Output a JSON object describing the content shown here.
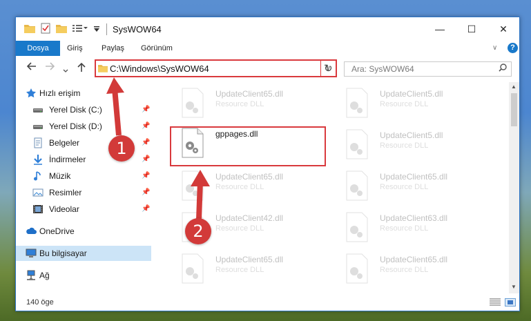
{
  "window": {
    "title": "SysWOW64",
    "minimize_glyph": "—",
    "maximize_glyph": "☐",
    "close_glyph": "✕"
  },
  "ribbon": {
    "tabs": [
      {
        "label": "Dosya"
      },
      {
        "label": "Giriş"
      },
      {
        "label": "Paylaş"
      },
      {
        "label": "Görünüm"
      }
    ],
    "expand_glyph": "∨",
    "help_glyph": "?"
  },
  "address": {
    "path": "C:\\Windows\\SysWOW64",
    "dropdown_glyph": "∨",
    "refresh_glyph": "↻"
  },
  "search": {
    "placeholder": "Ara: SysWOW64",
    "icon": "search-icon"
  },
  "nav": {
    "items": [
      {
        "label": "Hızlı erişim",
        "icon": "star-icon",
        "pinned": false
      },
      {
        "label": "Yerel Disk (C:)",
        "icon": "drive-icon",
        "pinned": true
      },
      {
        "label": "Yerel Disk (D:)",
        "icon": "drive-icon",
        "pinned": true
      },
      {
        "label": "Belgeler",
        "icon": "documents-icon",
        "pinned": true
      },
      {
        "label": "İndirmeler",
        "icon": "download-icon",
        "pinned": true
      },
      {
        "label": "Müzik",
        "icon": "music-icon",
        "pinned": true
      },
      {
        "label": "Resimler",
        "icon": "pictures-icon",
        "pinned": true
      },
      {
        "label": "Videolar",
        "icon": "videos-icon",
        "pinned": true
      },
      {
        "label": "OneDrive",
        "icon": "cloud-icon",
        "pinned": false
      },
      {
        "label": "Bu bilgisayar",
        "icon": "computer-icon",
        "pinned": false
      },
      {
        "label": "Ağ",
        "icon": "network-icon",
        "pinned": false
      }
    ]
  },
  "files": {
    "left": [
      {
        "name": "UpdateClient65.dll",
        "type": "Resource DLL"
      },
      {
        "name": "gppages.dll",
        "type": ""
      },
      {
        "name": "UpdateClient65.dll",
        "type": "Resource DLL"
      },
      {
        "name": "UpdateClient42.dll",
        "type": "Resource DLL"
      },
      {
        "name": "UpdateClient65.dll",
        "type": "Resource DLL"
      }
    ],
    "right": [
      {
        "name": "UpdateClient5.dll",
        "type": "Resource DLL"
      },
      {
        "name": "UpdateClient5.dll",
        "type": "Resource DLL"
      },
      {
        "name": "UpdateClient65.dll",
        "type": "Resource DLL"
      },
      {
        "name": "UpdateClient63.dll",
        "type": "Resource DLL"
      },
      {
        "name": "UpdateClient65.dll",
        "type": "Resource DLL"
      }
    ]
  },
  "status": {
    "count_text": "140 öge"
  },
  "annotations": {
    "step1": "1",
    "step2": "2",
    "accent": "#d9393d"
  },
  "colors": {
    "file_tab": "#1979ca",
    "selection": "#cce4f7",
    "highlight_border": "#d9393d"
  }
}
